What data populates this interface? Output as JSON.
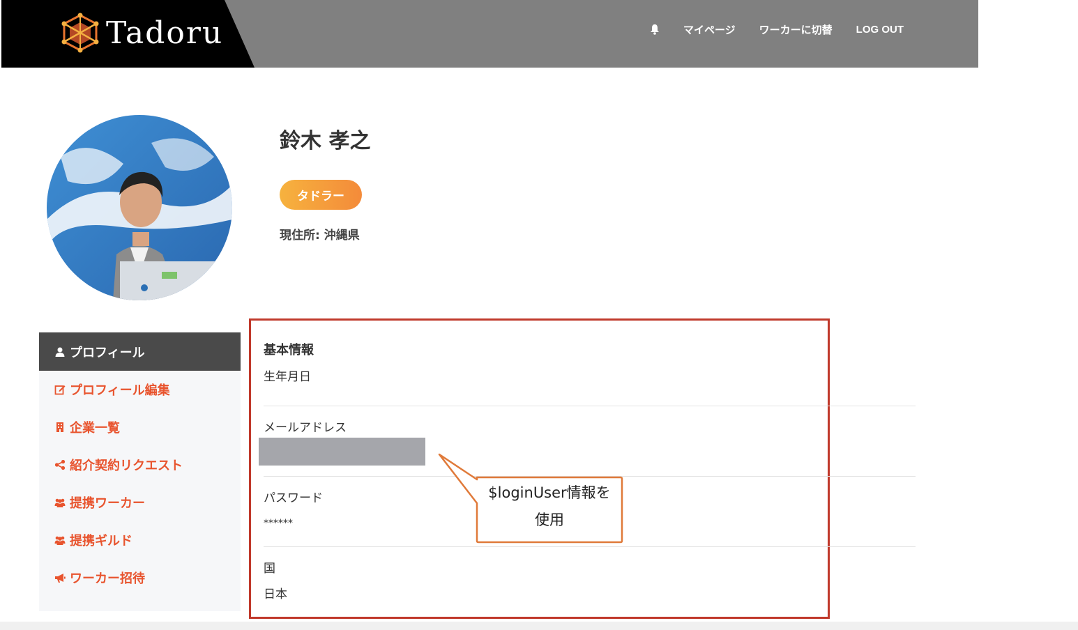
{
  "header": {
    "logo_text": "Tadoru",
    "nav": {
      "my_page": "マイページ",
      "switch_worker": "ワーカーに切替",
      "logout": "LOG OUT"
    }
  },
  "profile": {
    "name": "鈴木 孝之",
    "role_badge": "タドラー",
    "location": "現住所: 沖縄県"
  },
  "sidebar": {
    "active": "プロフィール",
    "items": [
      {
        "label": "プロフィール編集",
        "icon": "edit-icon"
      },
      {
        "label": "企業一覧",
        "icon": "building-icon"
      },
      {
        "label": "紹介契約リクエスト",
        "icon": "share-icon"
      },
      {
        "label": "提携ワーカー",
        "icon": "users-icon"
      },
      {
        "label": "提携ギルド",
        "icon": "users-icon"
      },
      {
        "label": "ワーカー招待",
        "icon": "megaphone-icon"
      }
    ]
  },
  "info": {
    "section_title": "基本情報",
    "birthdate_label": "生年月日",
    "email_label": "メールアドレス",
    "password_label": "パスワード",
    "password_value": "******",
    "country_label": "国",
    "country_value": "日本"
  },
  "callout": {
    "line1": "$loginUser情報を",
    "line2": "使用"
  },
  "colors": {
    "header_bg": "#808080",
    "accent_orange": "#e8542e",
    "badge_gradient_start": "#f6b23e",
    "badge_gradient_end": "#f48b3a",
    "frame_red": "#c0392b",
    "callout_border": "#e07a3a"
  }
}
